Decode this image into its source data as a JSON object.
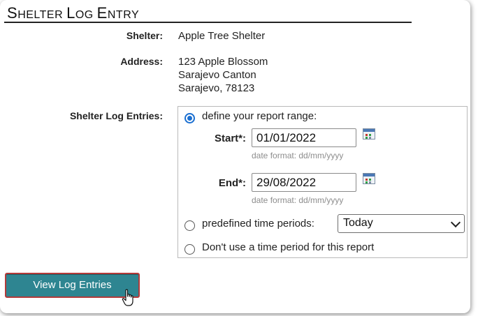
{
  "page": {
    "title_first": "S",
    "title_rest1": "HELTER ",
    "title_L": "L",
    "title_rest2": "OG ",
    "title_E": "E",
    "title_rest3": "NTRY"
  },
  "shelter": {
    "label": "Shelter:",
    "name": "Apple Tree Shelter"
  },
  "address": {
    "label": "Address:",
    "line1": "123 Apple Blossom",
    "line2": "Sarajevo Canton",
    "line3": "Sarajevo, 78123"
  },
  "log_entries": {
    "label": "Shelter Log Entries:",
    "options": {
      "define_range": "define your report range:",
      "predefined": "predefined time periods:",
      "no_period": "Don't use a time period for this report"
    },
    "selected": "define_range",
    "start": {
      "label": "Start*:",
      "value": "01/01/2022",
      "hint": "date format: dd/mm/yyyy"
    },
    "end": {
      "label": "End*:",
      "value": "29/08/2022",
      "hint": "date format: dd/mm/yyyy"
    },
    "predefined_select": {
      "value": "Today"
    }
  },
  "actions": {
    "view_button": "View Log Entries"
  },
  "colors": {
    "button_bg": "#2e8591",
    "button_border": "#b33a3a",
    "radio_accent": "#1a6fd1"
  },
  "icons": {
    "calendar": "calendar-icon",
    "dropdown": "chevron-down-icon",
    "cursor": "hand-pointer-cursor"
  }
}
